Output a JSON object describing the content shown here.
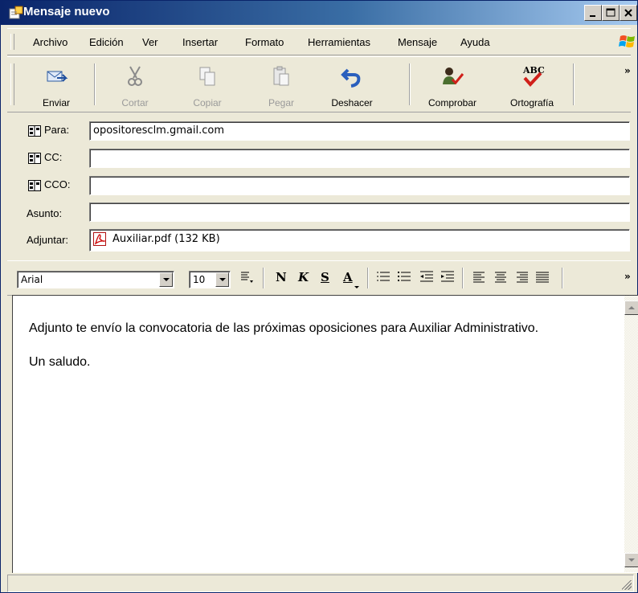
{
  "window": {
    "title": "Mensaje nuevo",
    "accent_color": "#0a246a",
    "controls": [
      "minimize-icon",
      "restore-icon",
      "close-icon"
    ]
  },
  "menubar": {
    "items": [
      {
        "label": "Archivo"
      },
      {
        "label": "Edición"
      },
      {
        "label": "Ver"
      },
      {
        "label": "Insertar"
      },
      {
        "label": "Formato"
      },
      {
        "label": "Herramientas"
      },
      {
        "label": "Mensaje"
      },
      {
        "label": "Ayuda"
      }
    ],
    "logo_icon": "windows-logo-icon"
  },
  "toolbar": {
    "buttons": [
      {
        "label": "Enviar",
        "icon": "send-icon",
        "enabled": true
      },
      {
        "label": "Cortar",
        "icon": "scissors-icon",
        "enabled": false
      },
      {
        "label": "Copiar",
        "icon": "copy-icon",
        "enabled": false
      },
      {
        "label": "Pegar",
        "icon": "paste-icon",
        "enabled": false
      },
      {
        "label": "Deshacer",
        "icon": "undo-icon",
        "enabled": true
      },
      {
        "label": "Comprobar",
        "icon": "check-names-icon",
        "enabled": true
      },
      {
        "label": "Ortografía",
        "icon": "spelling-icon",
        "enabled": true
      }
    ],
    "overflow": "»"
  },
  "header": {
    "to_label": "Para:",
    "to_value": "opositoresclm.gmail.com",
    "cc_label": "CC:",
    "cc_value": "",
    "bcc_label": "CCO:",
    "bcc_value": "",
    "subject_label": "Asunto:",
    "subject_value": "",
    "attach_label": "Adjuntar:",
    "attachment": "Auxiliar.pdf (132 KB)"
  },
  "formatbar": {
    "font": "Arial",
    "size": "10",
    "bold": "N",
    "italic": "K",
    "underline": "S",
    "font_color": "A",
    "overflow": "»"
  },
  "body": {
    "lines": [
      "Adjunto te envío la convocatoria de las próximas oposiciones para Auxiliar Administrativo.",
      "Un saludo."
    ]
  }
}
